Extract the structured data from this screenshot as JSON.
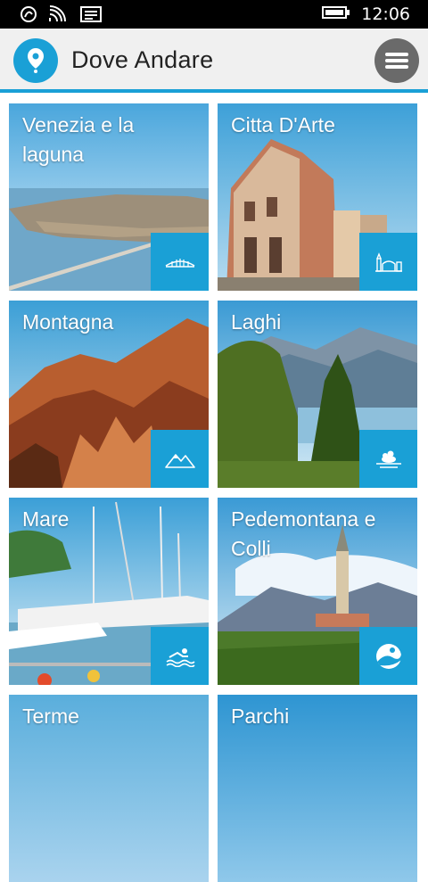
{
  "status_bar": {
    "time": "12:06",
    "icons": [
      "nfc-icon",
      "wifi-icon",
      "message-icon",
      "battery-icon"
    ]
  },
  "header": {
    "title": "Dove Andare",
    "logo_icon": "location-pin-icon",
    "menu_icon": "hamburger-menu-icon"
  },
  "tiles": [
    {
      "label": "Venezia e la laguna",
      "icon": "bridge-icon"
    },
    {
      "label": "Citta D'Arte",
      "icon": "city-icon"
    },
    {
      "label": "Montagna",
      "icon": "mountain-icon"
    },
    {
      "label": "Laghi",
      "icon": "lake-island-icon"
    },
    {
      "label": "Mare",
      "icon": "swimmer-icon"
    },
    {
      "label": "Pedemontana e Colli",
      "icon": "hills-icon"
    },
    {
      "label": "Terme",
      "icon": "spa-icon"
    },
    {
      "label": "Parchi",
      "icon": "park-icon"
    }
  ],
  "colors": {
    "accent": "#1aa0d6",
    "header_bg": "#f0f0f0",
    "menu_button": "#6a6a6a"
  }
}
